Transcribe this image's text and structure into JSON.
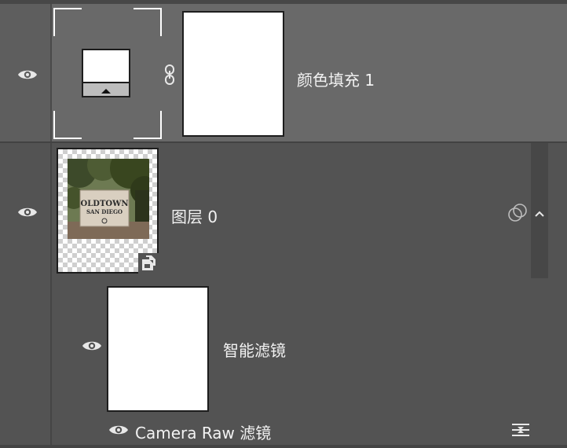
{
  "panel": {
    "name": "layers-panel"
  },
  "layers": [
    {
      "name": "颜色填充 1",
      "type": "color-fill",
      "selected": true,
      "visible": true,
      "mask_linked": true
    },
    {
      "name": "图层 0",
      "type": "smart-object",
      "visible": true,
      "expanded": true,
      "photo_text": [
        "OLDTOWN",
        "SAN DIEGO"
      ],
      "sub": {
        "smart_filters_label": "智能滤镜",
        "filters": [
          {
            "name": "Camera Raw 滤镜",
            "visible": true
          }
        ]
      }
    }
  ],
  "icons": {
    "eye": "eye-icon",
    "link": "link-chain-icon",
    "blend": "blending-options-icon",
    "collapse": "chevron-up-icon",
    "smart": "smart-object-icon",
    "filter_options": "filter-options-icon"
  },
  "colors": {
    "selected_row": "#696969",
    "panel_bg": "#535353",
    "text": "#f2f2f2"
  }
}
